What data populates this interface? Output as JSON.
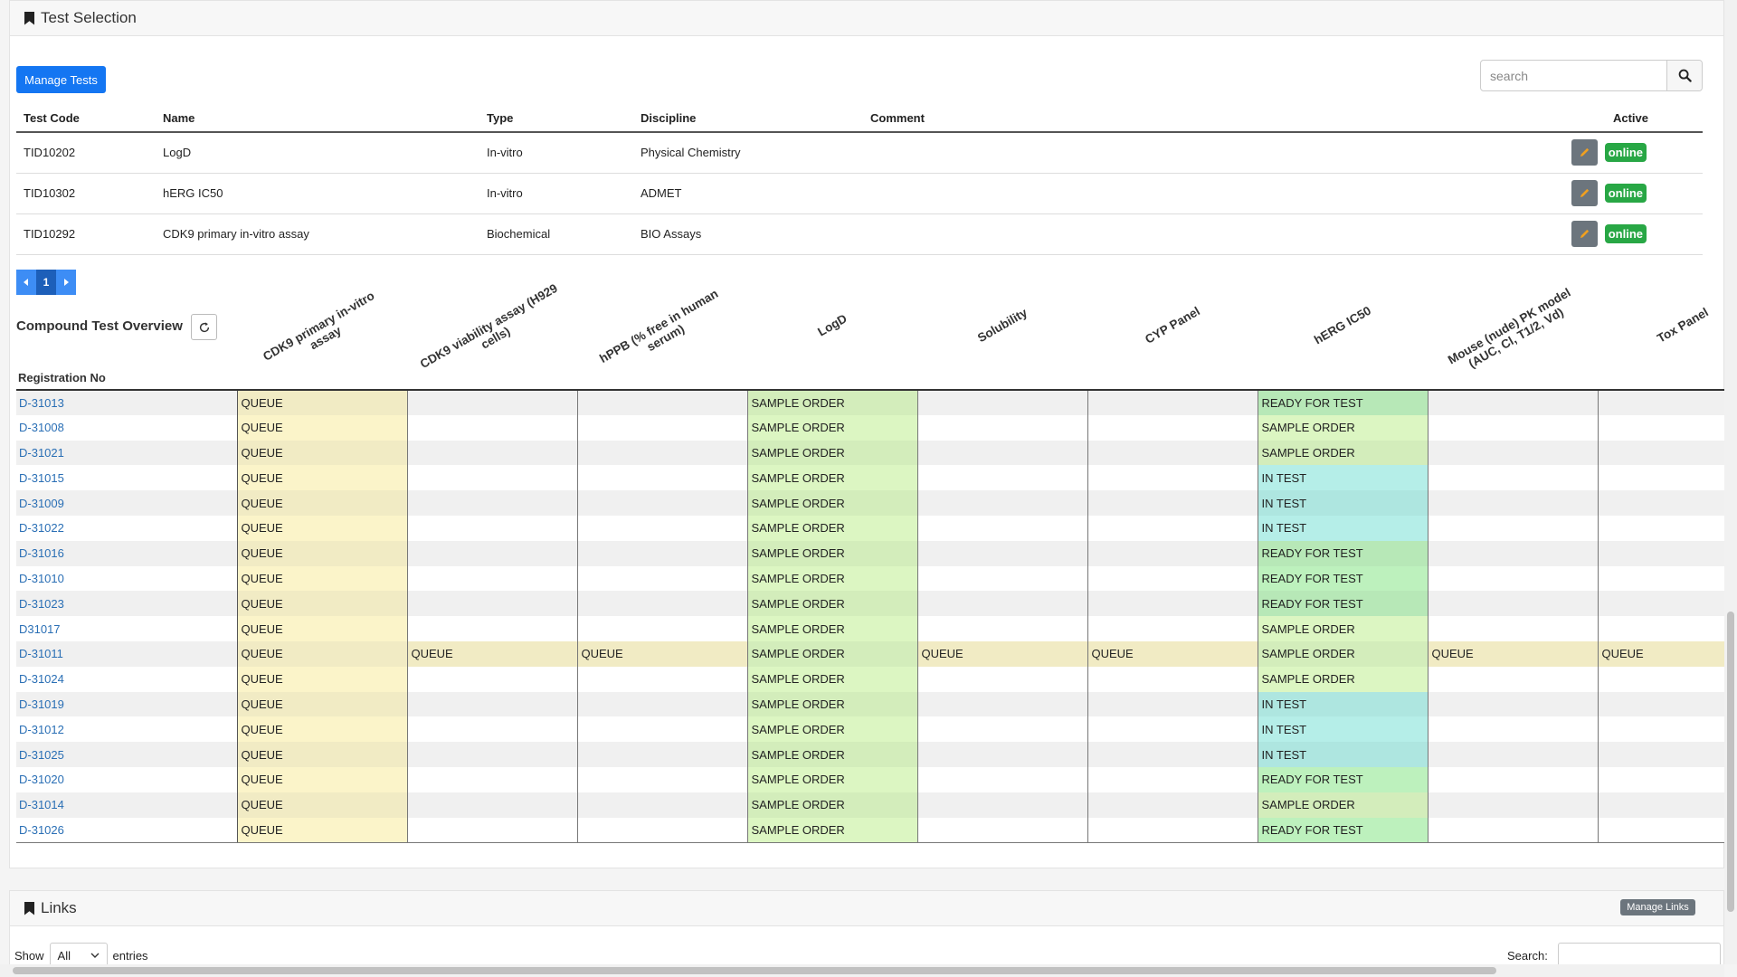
{
  "test_selection": {
    "title": "Test Selection",
    "manage_button": "Manage Tests",
    "search_placeholder": "search",
    "columns": [
      "Test Code",
      "Name",
      "Type",
      "Discipline",
      "Comment",
      "Active"
    ],
    "rows": [
      {
        "code": "TID10202",
        "name": "LogD",
        "type": "In-vitro",
        "discipline": "Physical Chemistry",
        "comment": "",
        "status": "online"
      },
      {
        "code": "TID10302",
        "name": "hERG IC50",
        "type": "In-vitro",
        "discipline": "ADMET",
        "comment": "",
        "status": "online"
      },
      {
        "code": "TID10292",
        "name": "CDK9 primary in-vitro assay",
        "type": "Biochemical",
        "discipline": "BIO Assays",
        "comment": "",
        "status": "online"
      }
    ],
    "pager_current": "1"
  },
  "overview": {
    "title": "Compound Test Overview",
    "reg_header": "Registration No",
    "columns": [
      "CDK9 primary in-vitro\nassay",
      "CDK9 viability assay (H929\ncells)",
      "hPPB (% free in human\nserum)",
      "LogD",
      "Solubility",
      "CYP Panel",
      "hERG IC50",
      "Mouse (nude) PK model\n(AUC, Cl, T1/2, Vd)",
      "Tox Panel"
    ],
    "rows": [
      {
        "reg": "D-31013",
        "cells": [
          "QUEUE",
          "",
          "",
          "SAMPLE ORDER",
          "",
          "",
          "READY FOR TEST",
          "",
          ""
        ]
      },
      {
        "reg": "D-31008",
        "cells": [
          "QUEUE",
          "",
          "",
          "SAMPLE ORDER",
          "",
          "",
          "SAMPLE ORDER",
          "",
          ""
        ]
      },
      {
        "reg": "D-31021",
        "cells": [
          "QUEUE",
          "",
          "",
          "SAMPLE ORDER",
          "",
          "",
          "SAMPLE ORDER",
          "",
          ""
        ]
      },
      {
        "reg": "D-31015",
        "cells": [
          "QUEUE",
          "",
          "",
          "SAMPLE ORDER",
          "",
          "",
          "IN TEST",
          "",
          ""
        ]
      },
      {
        "reg": "D-31009",
        "cells": [
          "QUEUE",
          "",
          "",
          "SAMPLE ORDER",
          "",
          "",
          "IN TEST",
          "",
          ""
        ]
      },
      {
        "reg": "D-31022",
        "cells": [
          "QUEUE",
          "",
          "",
          "SAMPLE ORDER",
          "",
          "",
          "IN TEST",
          "",
          ""
        ]
      },
      {
        "reg": "D-31016",
        "cells": [
          "QUEUE",
          "",
          "",
          "SAMPLE ORDER",
          "",
          "",
          "READY FOR TEST",
          "",
          ""
        ]
      },
      {
        "reg": "D-31010",
        "cells": [
          "QUEUE",
          "",
          "",
          "SAMPLE ORDER",
          "",
          "",
          "READY FOR TEST",
          "",
          ""
        ]
      },
      {
        "reg": "D-31023",
        "cells": [
          "QUEUE",
          "",
          "",
          "SAMPLE ORDER",
          "",
          "",
          "READY FOR TEST",
          "",
          ""
        ]
      },
      {
        "reg": "D31017",
        "cells": [
          "QUEUE",
          "",
          "",
          "SAMPLE ORDER",
          "",
          "",
          "SAMPLE ORDER",
          "",
          ""
        ]
      },
      {
        "reg": "D-31011",
        "cells": [
          "QUEUE",
          "QUEUE",
          "QUEUE",
          "SAMPLE ORDER",
          "QUEUE",
          "QUEUE",
          "SAMPLE ORDER",
          "QUEUE",
          "QUEUE"
        ]
      },
      {
        "reg": "D-31024",
        "cells": [
          "QUEUE",
          "",
          "",
          "SAMPLE ORDER",
          "",
          "",
          "SAMPLE ORDER",
          "",
          ""
        ]
      },
      {
        "reg": "D-31019",
        "cells": [
          "QUEUE",
          "",
          "",
          "SAMPLE ORDER",
          "",
          "",
          "IN TEST",
          "",
          ""
        ]
      },
      {
        "reg": "D-31012",
        "cells": [
          "QUEUE",
          "",
          "",
          "SAMPLE ORDER",
          "",
          "",
          "IN TEST",
          "",
          ""
        ]
      },
      {
        "reg": "D-31025",
        "cells": [
          "QUEUE",
          "",
          "",
          "SAMPLE ORDER",
          "",
          "",
          "IN TEST",
          "",
          ""
        ]
      },
      {
        "reg": "D-31020",
        "cells": [
          "QUEUE",
          "",
          "",
          "SAMPLE ORDER",
          "",
          "",
          "READY FOR TEST",
          "",
          ""
        ]
      },
      {
        "reg": "D-31014",
        "cells": [
          "QUEUE",
          "",
          "",
          "SAMPLE ORDER",
          "",
          "",
          "SAMPLE ORDER",
          "",
          ""
        ]
      },
      {
        "reg": "D-31026",
        "cells": [
          "QUEUE",
          "",
          "",
          "SAMPLE ORDER",
          "",
          "",
          "READY FOR TEST",
          "",
          ""
        ]
      }
    ]
  },
  "links": {
    "title": "Links",
    "manage_button": "Manage Links",
    "show_label": "Show",
    "show_value": "All",
    "entries_label": "entries",
    "search_label": "Search:"
  },
  "colors": {
    "primary": "#1476f2",
    "online": "#28a745",
    "queue": "#fbf4c9",
    "sample_order": "#dcf6c2",
    "ready_for_test": "#bdf1bd",
    "in_test": "#b5eee8"
  },
  "icons": [
    "bookmark-icon",
    "search-icon",
    "pencil-icon",
    "refresh-icon",
    "chevron-left-icon",
    "chevron-right-icon",
    "chevron-down-icon"
  ]
}
